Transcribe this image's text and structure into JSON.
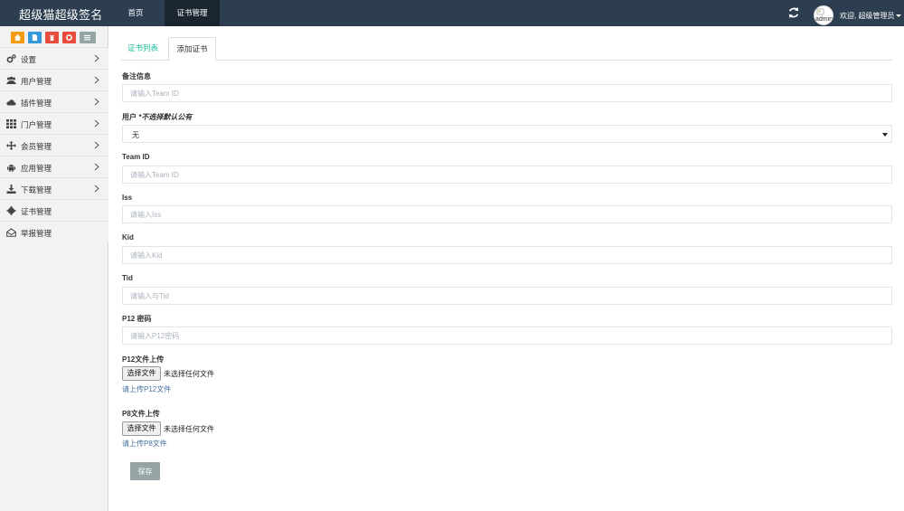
{
  "header": {
    "brand": "超级猫超级签名",
    "nav": [
      {
        "label": "首页"
      },
      {
        "label": "证书管理"
      }
    ],
    "avatar_text": "admin",
    "welcome": "欢迎, 超级管理员"
  },
  "colors": {
    "topbar": "#2c3e50",
    "active_nav": "#1a252f",
    "accent": "#18bc9c",
    "save_button": "#95a5a6"
  },
  "sidebar": {
    "shortcuts": [
      {
        "icon": "home-icon",
        "color": "#f39c12"
      },
      {
        "icon": "file-icon",
        "color": "#3498db"
      },
      {
        "icon": "trash-icon",
        "color": "#e74c3c"
      },
      {
        "icon": "lifebuoy-icon",
        "color": "#e74c3c"
      },
      {
        "icon": "list-icon",
        "color": "#95a5a6"
      }
    ],
    "items": [
      {
        "label": "设置",
        "icon": "cogs-icon",
        "has_children": true
      },
      {
        "label": "用户管理",
        "icon": "users-icon",
        "has_children": true
      },
      {
        "label": "插件管理",
        "icon": "cloud-icon",
        "has_children": true
      },
      {
        "label": "门户管理",
        "icon": "grid-icon",
        "has_children": true
      },
      {
        "label": "会员管理",
        "icon": "move-icon",
        "has_children": true
      },
      {
        "label": "应用管理",
        "icon": "android-icon",
        "has_children": true
      },
      {
        "label": "下载管理",
        "icon": "download-icon",
        "has_children": true
      },
      {
        "label": "证书管理",
        "icon": "gear-icon",
        "has_children": false
      },
      {
        "label": "举报管理",
        "icon": "envelope-icon",
        "has_children": false
      }
    ]
  },
  "tabs": [
    {
      "label": "证书列表",
      "active": false
    },
    {
      "label": "添加证书",
      "active": true
    }
  ],
  "form": {
    "remark": {
      "label": "备注信息",
      "placeholder": "请输入Team ID",
      "value": ""
    },
    "user": {
      "label_prefix": "用户",
      "label_note": " *不选择默认公有",
      "value": "无"
    },
    "team_id": {
      "label": "Team ID",
      "placeholder": "请输入Team ID",
      "value": ""
    },
    "iss": {
      "label": "Iss",
      "placeholder": "请输入Iss",
      "value": ""
    },
    "kid": {
      "label": "Kid",
      "placeholder": "请输入Kid",
      "value": ""
    },
    "tid": {
      "label": "Tid",
      "placeholder": "请输入与Tid",
      "value": ""
    },
    "p12_password": {
      "label": "P12 密码",
      "placeholder": "请输入P12密码",
      "value": ""
    },
    "p12_file": {
      "label": "P12文件上传",
      "button": "选择文件",
      "status": "未选择任何文件",
      "help": "请上传P12文件"
    },
    "p8_file": {
      "label": "P8文件上传",
      "button": "选择文件",
      "status": "未选择任何文件",
      "help": "请上传P8文件"
    },
    "save_label": "保存"
  }
}
